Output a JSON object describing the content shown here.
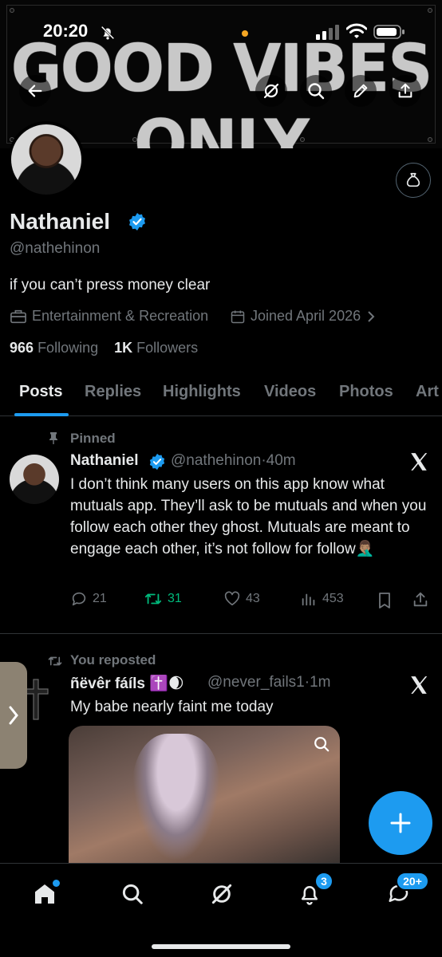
{
  "status_bar": {
    "time": "20:20"
  },
  "banner": {
    "text": "GOOD VIBES ONLY"
  },
  "profile": {
    "name": "Nathaniel",
    "handle": "@nathehinon",
    "bio": "if you can’t press money clear",
    "category": "Entertainment & Recreation",
    "joined": "Joined April 2026",
    "following_count": "966",
    "following_label": "Following",
    "followers_count": "1K",
    "followers_label": "Followers"
  },
  "tabs": [
    {
      "label": "Posts",
      "active": true
    },
    {
      "label": "Replies"
    },
    {
      "label": "Highlights"
    },
    {
      "label": "Videos"
    },
    {
      "label": "Photos"
    },
    {
      "label": "Art"
    }
  ],
  "pinned_post": {
    "context": "Pinned",
    "author": "Nathaniel",
    "handle": "@nathehinon",
    "time": "·40m",
    "text": "I don’t think many users on this app know what mutuals app. They’ll ask to be mutuals and when you follow each other they ghost. Mutuals are meant to engage each other, it’s not follow for follow🤦🏽‍♂️",
    "replies": "21",
    "reposts": "31",
    "likes": "43",
    "views": "453"
  },
  "repost": {
    "context": "You reposted",
    "author": "ñëvêr fáíls ✝️🌒",
    "handle": "@never_fails1",
    "time": "·1m",
    "text": "My babe nearly faint me today"
  },
  "bottom_nav": {
    "notifications_badge": "3",
    "messages_badge": "20+"
  },
  "colors": {
    "accent": "#1d9bf0",
    "repost_green": "#00ba7c",
    "muted": "#71767b"
  }
}
